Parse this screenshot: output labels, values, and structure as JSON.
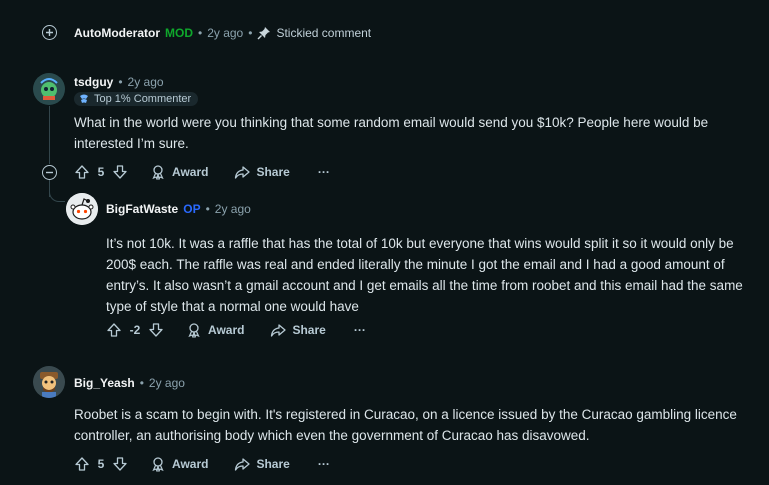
{
  "comments": {
    "automod": {
      "author": "AutoModerator",
      "mod_tag": "MOD",
      "sep1": "•",
      "age": "2y ago",
      "sep2": "•",
      "stickied": "Stickied comment"
    },
    "c1": {
      "author": "tsdguy",
      "sep": "•",
      "age": "2y ago",
      "flair": "Top 1% Commenter",
      "body": "What in the world were you thinking that some random email would send you $10k? People here would be interested I’m sure.",
      "votes": "5",
      "award": "Award",
      "share": "Share",
      "more": "···"
    },
    "c2": {
      "author": "BigFatWaste",
      "op_tag": "OP",
      "sep": "•",
      "age": "2y ago",
      "body": "It’s not 10k. It was a raffle that has the total of 10k but everyone that wins would split it so it would only be 200$ each. The raffle was real and ended literally the minute I got the email and I had a good amount of entry’s. It also wasn’t a gmail account and I get emails all the time from roobet and this email had the same type of style that a normal one would have",
      "votes": "-2",
      "award": "Award",
      "share": "Share",
      "more": "···"
    },
    "c3": {
      "author": "Big_Yeash",
      "sep": "•",
      "age": "2y ago",
      "body": "Roobet is a scam to begin with. It's registered in Curacao, on a licence issued by the Curacao gambling licence controller, an authorising body which even the government of Curacao has disavowed.",
      "votes": "5",
      "award": "Award",
      "share": "Share",
      "more": "···"
    }
  },
  "icons": {
    "expand": "plus-circle-icon",
    "collapse": "minus-circle-icon",
    "pin": "pin-icon",
    "upvote": "upvote-arrow-icon",
    "downvote": "downvote-arrow-icon",
    "award": "award-icon",
    "share": "share-icon"
  },
  "colors": {
    "background": "#0b1416",
    "mod": "#0fa82c",
    "op": "#2a69fe",
    "text": "#dde6ea",
    "meta": "#8ba2ad"
  }
}
